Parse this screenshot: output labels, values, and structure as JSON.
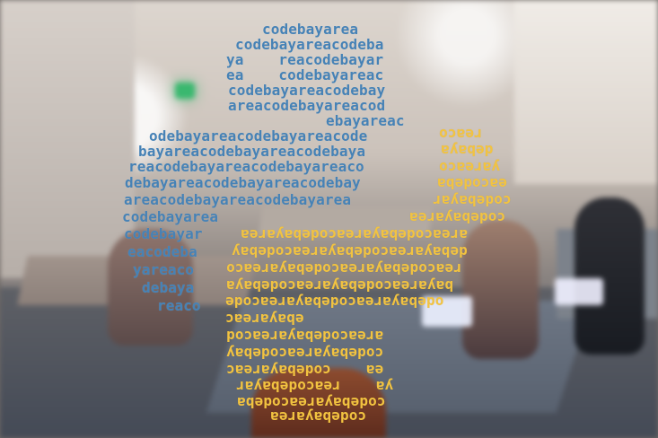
{
  "graphic": {
    "text_repeat_a": [
      "codebayarea",
      "codebayareacodeba",
      "ya    reacodebayar",
      "ea    codebayareac",
      "codebayareacodebay",
      "areacodebayareacod",
      "ebayareac",
      "odebayareacodebayareacode",
      "bayareacodebayareacodebaya",
      "reacodebayareacodebayareaco",
      "debayareacodebayareacodebay",
      "areacodebayareacodebayarea",
      "codebayarea",
      "codebayar",
      "eacodeba",
      "yareaco",
      "debaya",
      "reaco"
    ],
    "text_repeat_b": [
      "reaco",
      "debaya",
      "yareaco",
      "eacodeba",
      "codebayar",
      "codebayarea",
      "areacodebayareacodebayarea",
      "debayareacodebayareacodebay",
      "reacodebayareacodebayareaco",
      "bayareacodebayareacodebaya",
      "odebayareacodebayareacode",
      "ebayareac",
      "areacodebayareacod",
      "codebayareacodebay",
      "ea    codebayareac",
      "ya    reacodebayar",
      "codebayareacodeba",
      "codebayarea"
    ]
  },
  "colors": {
    "blue_text": "#4682b6",
    "yellow_text": "#f2c340"
  }
}
